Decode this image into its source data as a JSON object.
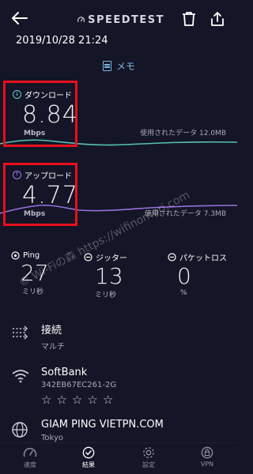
{
  "header": {
    "logo_text": "SPEEDTEST",
    "datetime": "2019/10/28 21:24",
    "memo_label": "メモ"
  },
  "download": {
    "label": "ダウンロード",
    "value": "8.84",
    "unit": "Mbps",
    "data_used": "使用されたデータ 12.0MB",
    "color": "#5fd4c9"
  },
  "upload": {
    "label": "アップロード",
    "value": "4.77",
    "unit": "Mbps",
    "data_used": "使用されたデータ 7.3MB",
    "color": "#a77bf3"
  },
  "stats": {
    "ping": {
      "label": "Ping",
      "value": "27",
      "unit": "ミリ秒"
    },
    "jitter": {
      "label": "ジッター",
      "value": "13",
      "unit": "ミリ秒"
    },
    "loss": {
      "label": "パケットロス",
      "value": "0",
      "unit": "%"
    }
  },
  "connection": {
    "title": "接続",
    "sub": "マルチ"
  },
  "network": {
    "title": "SoftBank",
    "sub": "342EB67EC261-2G"
  },
  "server": {
    "title": "GIAM PING VIETPN.COM",
    "sub": "Tokyo"
  },
  "nav": [
    {
      "label": "速度",
      "icon": "speed-gauge-icon"
    },
    {
      "label": "結果",
      "icon": "results-check-icon"
    },
    {
      "label": "設定",
      "icon": "settings-gear-icon"
    },
    {
      "label": "VPN",
      "icon": "vpn-lock-icon"
    }
  ],
  "watermark": "© Wi-Fiの森 https://wifinomori.com"
}
